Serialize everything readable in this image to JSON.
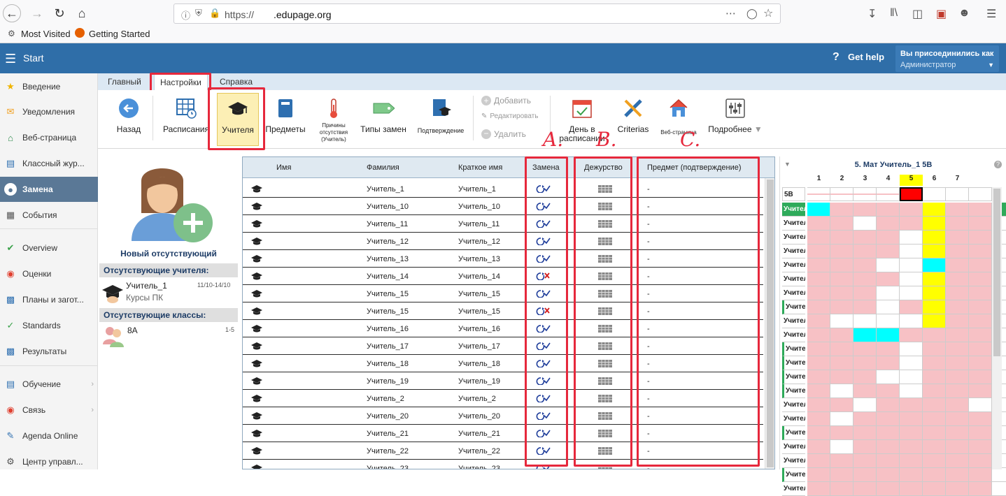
{
  "browser": {
    "url_scheme": "https://",
    "url_host": ".edupage.org",
    "bookmarks": [
      "Most Visited",
      "Getting Started"
    ]
  },
  "app": {
    "start_label": "Start",
    "get_help": "Get help",
    "joined_label": "Вы присоединились как",
    "joined_role": "Администратор"
  },
  "sidebar": {
    "items": [
      {
        "label": "Введение",
        "icon": "star-icon",
        "color": "#f0b400"
      },
      {
        "label": "Уведомления",
        "icon": "envelope-icon",
        "color": "#f0a020"
      },
      {
        "label": "Веб-страница",
        "icon": "house-icon",
        "color": "#2c8a4a"
      },
      {
        "label": "Классный жур...",
        "icon": "journal-icon",
        "color": "#2e6fb0"
      },
      {
        "label": "Замена",
        "icon": "user-circle-icon",
        "color": "#ffffff"
      },
      {
        "label": "События",
        "icon": "calendar-icon",
        "color": "#555555"
      },
      {
        "label": "Overview",
        "icon": "check-circle-icon",
        "color": "#3aa14a"
      },
      {
        "label": "Оценки",
        "icon": "grades-icon",
        "color": "#e04030"
      },
      {
        "label": "Планы и загот...",
        "icon": "briefcase-icon",
        "color": "#2e6fb0"
      },
      {
        "label": "Standards",
        "icon": "shield-check-icon",
        "color": "#3aa14a"
      },
      {
        "label": "Результаты",
        "icon": "bar-chart-icon",
        "color": "#2e6fb0"
      },
      {
        "label": "Обучение",
        "icon": "book-icon",
        "color": "#2e6fb0"
      },
      {
        "label": "Связь",
        "icon": "chat-icon",
        "color": "#e04030"
      },
      {
        "label": "Agenda Online",
        "icon": "pen-icon",
        "color": "#2e6fb0"
      },
      {
        "label": "Центр управл...",
        "icon": "control-icon",
        "color": "#555555"
      }
    ]
  },
  "ribbon": {
    "tabs": [
      "Главный",
      "Настройки",
      "Справка"
    ],
    "buttons": {
      "back": "Назад",
      "schedules": "Расписания",
      "teachers": "Учителя",
      "subjects": "Предметы",
      "absence_reasons_1": "Причины",
      "absence_reasons_2": "отсутствия",
      "absence_reasons_3": "(Учитель)",
      "sub_types": "Типы замен",
      "confirmation": "Подтверждение",
      "add": "Добавить",
      "edit": "Редактировать",
      "delete": "Удалить",
      "day_in_schedule_1": "День в",
      "day_in_schedule_2": "расписании",
      "criterias": "Criterias",
      "web_page": "Веб-страница",
      "more": "Подробнее"
    },
    "annotations": [
      "A.",
      "B.",
      "C."
    ]
  },
  "left_panel": {
    "new_absent": "Новый отсутствующий",
    "absent_teachers_header": "Отсутствующие учителя:",
    "absent_teacher": {
      "name": "Учитель_1",
      "dates": "11/10-14/10",
      "reason": "Курсы ПК"
    },
    "absent_classes_header": "Отсутствующие классы:",
    "absent_class": {
      "name": "8А",
      "periods": "1-5"
    }
  },
  "table": {
    "headers": {
      "name": "Имя",
      "surname": "Фамилия",
      "short": "Краткое имя",
      "sub": "Замена",
      "duty": "Дежурство",
      "subject_confirm": "Предмет (подтверждение)"
    },
    "rows": [
      {
        "surname": "Учитель_1",
        "short": "Учитель_1",
        "sub": "ok",
        "subject": "-"
      },
      {
        "surname": "Учитель_10",
        "short": "Учитель_10",
        "sub": "ok",
        "subject": "-"
      },
      {
        "surname": "Учитель_11",
        "short": "Учитель_11",
        "sub": "ok",
        "subject": "-"
      },
      {
        "surname": "Учитель_12",
        "short": "Учитель_12",
        "sub": "ok",
        "subject": "-"
      },
      {
        "surname": "Учитель_13",
        "short": "Учитель_13",
        "sub": "ok",
        "subject": "-"
      },
      {
        "surname": "Учитель_14",
        "short": "Учитель_14",
        "sub": "no",
        "subject": "-"
      },
      {
        "surname": "Учитель_15",
        "short": "Учитель_15",
        "sub": "ok",
        "subject": "-"
      },
      {
        "surname": "Учитель_15",
        "short": "Учитель_15",
        "sub": "no",
        "subject": "-"
      },
      {
        "surname": "Учитель_16",
        "short": "Учитель_16",
        "sub": "ok",
        "subject": "-"
      },
      {
        "surname": "Учитель_17",
        "short": "Учитель_17",
        "sub": "ok",
        "subject": "-"
      },
      {
        "surname": "Учитель_18",
        "short": "Учитель_18",
        "sub": "ok",
        "subject": "-"
      },
      {
        "surname": "Учитель_19",
        "short": "Учитель_19",
        "sub": "ok",
        "subject": "-"
      },
      {
        "surname": "Учитель_2",
        "short": "Учитель_2",
        "sub": "ok",
        "subject": "-"
      },
      {
        "surname": "Учитель_20",
        "short": "Учитель_20",
        "sub": "ok",
        "subject": "-"
      },
      {
        "surname": "Учитель_21",
        "short": "Учитель_21",
        "sub": "ok",
        "subject": "-"
      },
      {
        "surname": "Учитель_22",
        "short": "Учитель_22",
        "sub": "ok",
        "subject": "-"
      },
      {
        "surname": "Учитель_23",
        "short": "Учитель_23",
        "sub": "ok",
        "subject": "-"
      }
    ]
  },
  "timetable": {
    "title": "5. Мат Учитель_1 5В",
    "periods": [
      "1",
      "2",
      "3",
      "4",
      "5",
      "6",
      "7"
    ],
    "class_row_label": "5В",
    "row_label": "Учитель",
    "colors": {
      "p": "#f7c1c5",
      "w": "#ffffff",
      "y": "#ffff00",
      "c": "#00ffff",
      "r": "#ff0000",
      "g": "#2eaa5a"
    },
    "rows": [
      "cppppyppg",
      "ppwppyppw",
      "ppppwyppw",
      "ppppwyppw",
      "pppwwcppw",
      "ppppwyppw",
      "pppwwyppw",
      "pppwpyppw",
      "pwwwwyppw",
      "ppccppppw",
      "ppppwpppw",
      "ppppwpppw",
      "pppwwpppw",
      "pwppwpppw",
      "ppwppppww",
      "pwppppppw",
      "ppppppppw",
      "pwppppppw",
      "ppppppppw",
      "ppppppppw",
      "ppppppppw"
    ]
  }
}
